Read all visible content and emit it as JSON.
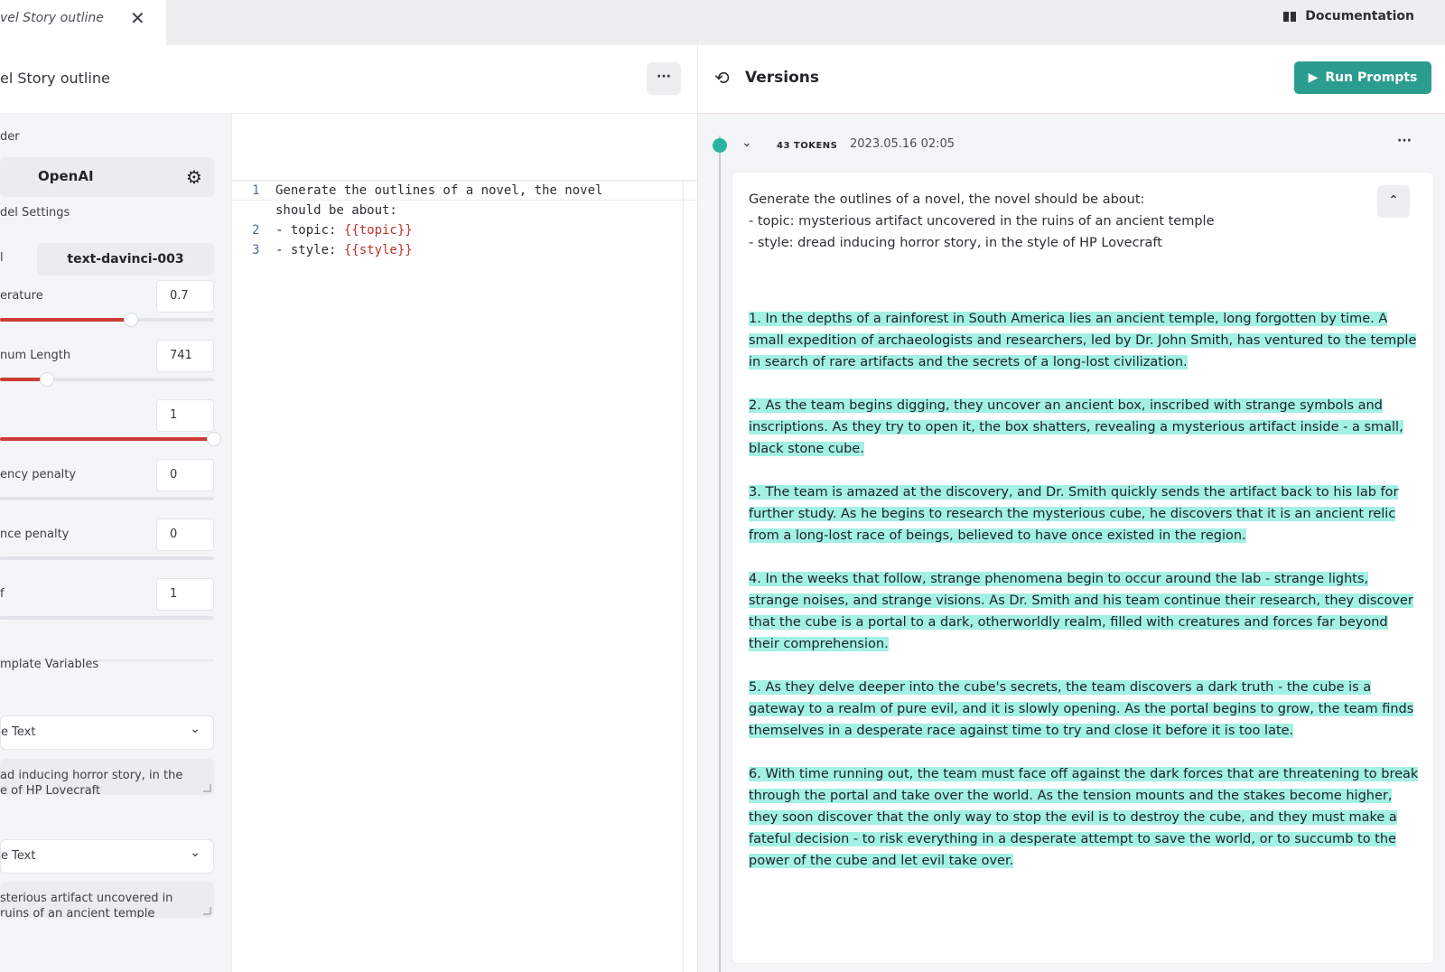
{
  "tab": {
    "title": "vel Story outline",
    "close_icon": "close-icon"
  },
  "header": {
    "documentation_label": "Documentation",
    "page_title": "el Story outline",
    "more_label": "···"
  },
  "settings": {
    "provider_label": "der",
    "provider": "OpenAI",
    "model_settings_label": "del Settings",
    "model_label": "l",
    "model": "text-davinci-003",
    "params": [
      {
        "label": "erature",
        "value": "0.7",
        "level": 0.61
      },
      {
        "label": "num Length",
        "value": "741",
        "level": 0.22
      },
      {
        "label": "",
        "value": "1",
        "level": 1.0
      },
      {
        "label": "ency penalty",
        "value": "0",
        "level": 0.0
      },
      {
        "label": "nce penalty",
        "value": "0",
        "level": 0.0
      },
      {
        "label": "f",
        "value": "1",
        "level": 0.0
      }
    ],
    "template_variables_label": "mplate Variables",
    "variables": [
      {
        "name": "",
        "type": "e Text",
        "value_line1": "ad inducing horror story, in the",
        "value_line2": "e of HP Lovecraft"
      },
      {
        "name": "",
        "type": "e Text",
        "value_line1": "sterious artifact uncovered in",
        "value_line2": "ruins of an ancient temple"
      }
    ]
  },
  "editor": {
    "lines": [
      {
        "num": "1",
        "text": "Generate the outlines of a novel, the novel",
        "cont": "should be about:"
      },
      {
        "num": "2",
        "prefix": "- topic: ",
        "var": "{{topic}}"
      },
      {
        "num": "3",
        "prefix": "- style: ",
        "var": "{{style}}"
      }
    ]
  },
  "versions": {
    "title": "Versions",
    "run_label": "Run Prompts",
    "tokens": "43 TOKENS",
    "date": "2023.05.16 02:05",
    "more_label": "···",
    "prompt_lines": [
      "Generate the outlines of a novel, the novel should be about:",
      "- topic: mysterious artifact uncovered in the ruins of an ancient temple",
      "- style: dread inducing horror story, in the style of HP Lovecraft"
    ],
    "response": [
      "1. In the depths of a rainforest in South America lies an ancient temple, long forgotten by time. A small expedition of archaeologists and researchers, led by Dr. John Smith, has ventured to the temple in search of rare artifacts and the secrets of a long-lost civilization.",
      "2. As the team begins digging, they uncover an ancient box, inscribed with strange symbols and inscriptions. As they try to open it, the box shatters, revealing a mysterious artifact inside - a small, black stone cube.",
      "3. The team is amazed at the discovery, and Dr. Smith quickly sends the artifact back to his lab for further study. As he begins to research the mysterious cube, he discovers that it is an ancient relic from a long-lost race of beings, believed to have once existed in the region.",
      "4. In the weeks that follow, strange phenomena begin to occur around the lab - strange lights, strange noises, and strange visions. As Dr. Smith and his team continue their research, they discover that the cube is a portal to a dark, otherworldly realm, filled with creatures and forces far beyond their comprehension.",
      "5. As they delve deeper into the cube's secrets, the team discovers a dark truth - the cube is a gateway to a realm of pure evil, and it is slowly opening. As the portal begins to grow, the team finds themselves in a desperate race against time to try and close it before it is too late.",
      "6. With time running out, the team must face off against the dark forces that are threatening to break through the portal and take over the world. As the tension mounts and the stakes become higher, they soon discover that the only way to stop the evil is to destroy the cube, and they must make a fateful decision - to risk everything in a desperate attempt to save the world, or to succumb to the power of the cube and let evil take over."
    ]
  },
  "colors": {
    "accent": "#2a9d8f",
    "slider": "#cc3b34",
    "highlight": "#a3f0e4",
    "template_var": "#c0322c"
  }
}
